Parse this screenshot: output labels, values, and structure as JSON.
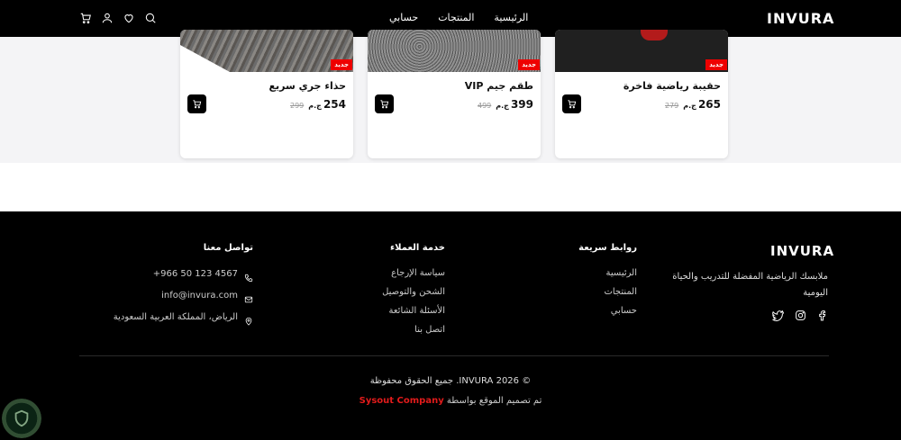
{
  "header": {
    "brand": "INVURA",
    "nav": [
      "الرئيسية",
      "المنتجات",
      "حسابي"
    ],
    "icons": [
      "cart-icon",
      "user-icon",
      "heart-icon",
      "search-icon"
    ]
  },
  "products": [
    {
      "badge": "جديد",
      "name": "حقيبة رياضية فاخرة",
      "price": "265",
      "currency": "ج.م",
      "old_price": "279"
    },
    {
      "badge": "جديد",
      "name": "طقم جيم VIP",
      "price": "399",
      "currency": "ج.م",
      "old_price": "499"
    },
    {
      "badge": "جديد",
      "name": "حذاء جري سريع",
      "price": "254",
      "currency": "ج.م",
      "old_price": "299"
    }
  ],
  "footer": {
    "brand": "INVURA",
    "description": "ملابسك الرياضية المفضلة للتدريب والحياة اليومية",
    "social": [
      "facebook-icon",
      "instagram-icon",
      "twitter-icon"
    ],
    "quick_links": {
      "title": "روابط سريعة",
      "items": [
        "الرئيسية",
        "المنتجات",
        "حسابي"
      ]
    },
    "customer_service": {
      "title": "خدمة العملاء",
      "items": [
        "سياسة الإرجاع",
        "الشحن والتوصيل",
        "الأسئلة الشائعة",
        "اتصل بنا"
      ]
    },
    "contact": {
      "title": "تواصل معنا",
      "phone": "+966 50 123 4567",
      "email": "info@invura.com",
      "address": "الرياض، المملكة العربية السعودية"
    },
    "copyright": "© 2026 INVURA. جميع الحقوق محفوظة",
    "credit_prefix": "تم تصميم الموقع بواسطة",
    "credit_company": "Sysout Company"
  }
}
